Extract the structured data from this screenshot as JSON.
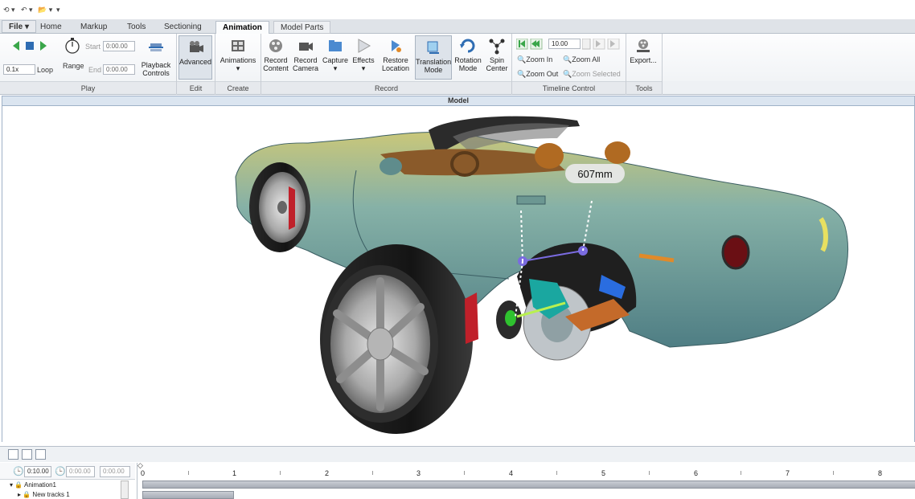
{
  "quick_access": {
    "items": [
      "⟲ ▾",
      "↶ ▾",
      "📂 ▾",
      "▾"
    ]
  },
  "tabs": {
    "file": "File ▾",
    "items": [
      "Home",
      "Markup",
      "Tools",
      "Sectioning",
      "Animation"
    ],
    "active": "Animation",
    "context": "Model Parts"
  },
  "ribbon": {
    "play": {
      "label": "Play",
      "speed": "0.1x",
      "loop": "Loop",
      "range": "Range",
      "start_label": "Start",
      "start_value": "0:00.00",
      "end_label": "End",
      "end_value": "0:00.00",
      "playback_controls": "Playback Controls"
    },
    "edit": {
      "label": "Edit",
      "advanced": "Advanced"
    },
    "create": {
      "label": "Create",
      "animations": "Animations"
    },
    "record": {
      "label": "Record",
      "record_content": "Record Content",
      "record_camera": "Record Camera",
      "capture": "Capture",
      "effects": "Effects",
      "restore_location": "Restore Location",
      "translation_mode": "Translation Mode",
      "rotation_mode": "Rotation Mode",
      "spin_center": "Spin Center"
    },
    "timeline_control": {
      "label": "Timeline Control",
      "value": "10.00",
      "zoom_in": "Zoom In",
      "zoom_all": "Zoom All",
      "zoom_out": "Zoom Out",
      "zoom_selected": "Zoom Selected"
    },
    "tools": {
      "label": "Tools",
      "export": "Export..."
    }
  },
  "viewport": {
    "title": "Model",
    "measurement": "607mm"
  },
  "timeline": {
    "duration": "0:10.00",
    "current": "0:00.00",
    "cursor": "0:00.00",
    "ruler_labels": [
      "0",
      "1",
      "2",
      "3",
      "4",
      "5",
      "6",
      "7",
      "8"
    ],
    "tree": {
      "animation": "Animation1",
      "track": "New tracks 1"
    }
  },
  "colors": {
    "car_body": "#7fa8a0",
    "tire": "#1b1b1b",
    "caliper": "#c0202a",
    "accent": "#2f6db3"
  }
}
